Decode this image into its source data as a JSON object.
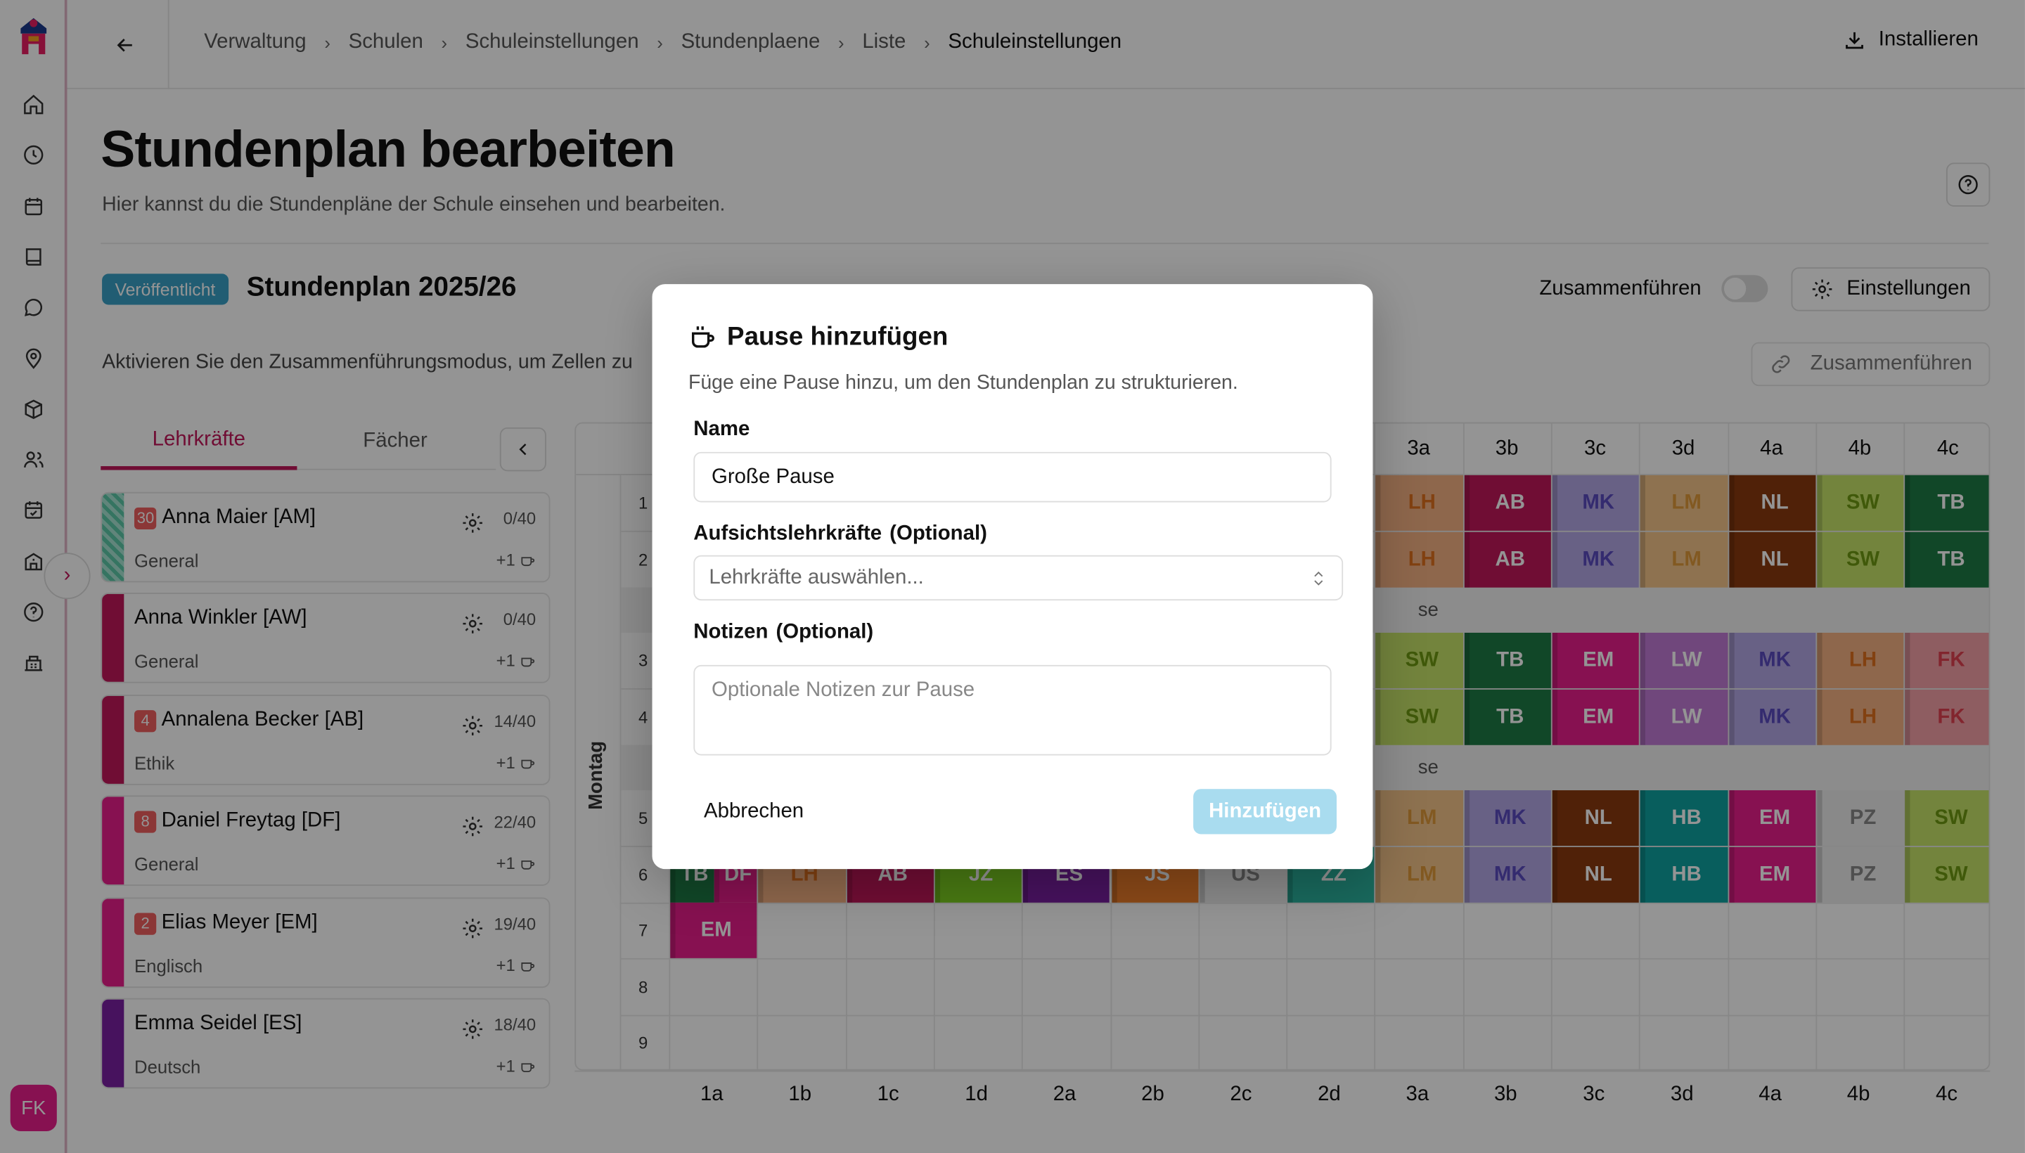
{
  "topbar": {
    "breadcrumb": [
      "Verwaltung",
      "Schulen",
      "Schuleinstellungen",
      "Stundenplaene",
      "Liste",
      "Schuleinstellungen"
    ],
    "install_label": "Installieren"
  },
  "sidebar": {
    "icons": [
      "home-icon",
      "clock-icon",
      "calendar-icon",
      "book-icon",
      "chat-icon",
      "map-pin-icon",
      "package-icon",
      "users-icon",
      "calendar-check-icon",
      "school-icon",
      "help-icon",
      "building-icon"
    ],
    "user_initials": "FK"
  },
  "page": {
    "title": "Stundenplan bearbeiten",
    "subtitle": "Hier kannst du die Stundenpläne der Schule einsehen und bearbeiten."
  },
  "plan": {
    "status_badge": "Veröffentlicht",
    "name": "Stundenplan 2025/26",
    "merge_toggle_label": "Zusammenführen",
    "settings_label": "Einstellungen",
    "merge_info": "Aktivieren Sie den Zusammenführungsmodus, um Zellen zu",
    "merge_button_label": "Zusammenführen"
  },
  "tabs": [
    {
      "label": "Lehrkräfte",
      "active": true
    },
    {
      "label": "Fächer",
      "active": false
    }
  ],
  "teachers": [
    {
      "badge": "30",
      "name": "Anna Maier [AM]",
      "subject": "General",
      "count": "0/40",
      "extra": "+1",
      "color": "#5cc8a8",
      "striped": true
    },
    {
      "badge": "",
      "name": "Anna Winkler [AW]",
      "subject": "General",
      "count": "0/40",
      "extra": "+1",
      "color": "#c2185b",
      "striped": false
    },
    {
      "badge": "4",
      "name": "Annalena Becker [AB]",
      "subject": "Ethik",
      "count": "14/40",
      "extra": "+1",
      "color": "#c2185b",
      "striped": false
    },
    {
      "badge": "8",
      "name": "Daniel Freytag [DF]",
      "subject": "General",
      "count": "22/40",
      "extra": "+1",
      "color": "#e91e8c",
      "striped": false
    },
    {
      "badge": "2",
      "name": "Elias Meyer [EM]",
      "subject": "Englisch",
      "count": "19/40",
      "extra": "+1",
      "color": "#e91e8c",
      "striped": false
    },
    {
      "badge": "",
      "name": "Emma Seidel [ES]",
      "subject": "Deutsch",
      "count": "18/40",
      "extra": "+1",
      "color": "#7b1fa2",
      "striped": false
    }
  ],
  "grid": {
    "classes": [
      "1a",
      "1b",
      "1c",
      "1d",
      "2a",
      "2b",
      "2c",
      "2d",
      "3a",
      "3b",
      "3c",
      "3d",
      "4a",
      "4b",
      "4c"
    ],
    "visible_header_classes": [
      "3a",
      "3b",
      "3c",
      "3d",
      "4a",
      "4b",
      "4c"
    ],
    "periods": [
      "1",
      "2",
      "3",
      "4",
      "5",
      "6",
      "7",
      "8",
      "9"
    ],
    "day": "Montag",
    "pause_fragment": "se",
    "lessons": [
      {
        "period": 1,
        "class": "3a",
        "code": "LH",
        "color": "#f4b183"
      },
      {
        "period": 1,
        "class": "3b",
        "code": "AB",
        "color": "#c2185b"
      },
      {
        "period": 1,
        "class": "3c",
        "code": "MK",
        "color": "#b4a7e5"
      },
      {
        "period": 1,
        "class": "3d",
        "code": "LM",
        "color": "#f4c48a"
      },
      {
        "period": 1,
        "class": "4a",
        "code": "NL",
        "color": "#8b3a0f"
      },
      {
        "period": 1,
        "class": "4b",
        "code": "SW",
        "color": "#c6e46a"
      },
      {
        "period": 1,
        "class": "4c",
        "code": "TB",
        "color": "#1e7a45"
      },
      {
        "period": 2,
        "class": "3a",
        "code": "LH",
        "color": "#f4b183"
      },
      {
        "period": 2,
        "class": "3b",
        "code": "AB",
        "color": "#c2185b"
      },
      {
        "period": 2,
        "class": "3c",
        "code": "MK",
        "color": "#b4a7e5"
      },
      {
        "period": 2,
        "class": "3d",
        "code": "LM",
        "color": "#f4c48a"
      },
      {
        "period": 2,
        "class": "4a",
        "code": "NL",
        "color": "#8b3a0f"
      },
      {
        "period": 2,
        "class": "4b",
        "code": "SW",
        "color": "#c6e46a"
      },
      {
        "period": 2,
        "class": "4c",
        "code": "TB",
        "color": "#1e7a45"
      },
      {
        "period": 3,
        "class": "3a",
        "code": "SW",
        "color": "#c6e46a"
      },
      {
        "period": 3,
        "class": "3b",
        "code": "TB",
        "color": "#1e7a45"
      },
      {
        "period": 3,
        "class": "3c",
        "code": "EM",
        "color": "#e91e8c"
      },
      {
        "period": 3,
        "class": "3d",
        "code": "LW",
        "color": "#c27bd6"
      },
      {
        "period": 3,
        "class": "4a",
        "code": "MK",
        "color": "#b4a7e5"
      },
      {
        "period": 3,
        "class": "4b",
        "code": "LH",
        "color": "#f4b183"
      },
      {
        "period": 3,
        "class": "4c",
        "code": "FK",
        "color": "#f4a0a8"
      },
      {
        "period": 4,
        "class": "3a",
        "code": "SW",
        "color": "#c6e46a"
      },
      {
        "period": 4,
        "class": "3b",
        "code": "TB",
        "color": "#1e7a45"
      },
      {
        "period": 4,
        "class": "3c",
        "code": "EM",
        "color": "#e91e8c"
      },
      {
        "period": 4,
        "class": "3d",
        "code": "LW",
        "color": "#c27bd6"
      },
      {
        "period": 4,
        "class": "4a",
        "code": "MK",
        "color": "#b4a7e5"
      },
      {
        "period": 4,
        "class": "4b",
        "code": "LH",
        "color": "#f4b183"
      },
      {
        "period": 4,
        "class": "4c",
        "code": "FK",
        "color": "#f4a0a8"
      },
      {
        "period": 5,
        "class": "3a",
        "code": "LM",
        "color": "#f4c48a"
      },
      {
        "period": 5,
        "class": "3b",
        "code": "MK",
        "color": "#b4a7e5"
      },
      {
        "period": 5,
        "class": "3c",
        "code": "NL",
        "color": "#8b3a0f"
      },
      {
        "period": 5,
        "class": "3d",
        "code": "HB",
        "color": "#0fa3a0"
      },
      {
        "period": 5,
        "class": "4a",
        "code": "EM",
        "color": "#e91e8c"
      },
      {
        "period": 5,
        "class": "4b",
        "code": "PZ",
        "color": "#ececec"
      },
      {
        "period": 5,
        "class": "4c",
        "code": "SW",
        "color": "#c6e46a"
      },
      {
        "period": 6,
        "class": "1a",
        "code": "TB",
        "color": "#1e7a45"
      },
      {
        "period": 6,
        "class": "1a",
        "code": "DF",
        "color": "#e91e8c"
      },
      {
        "period": 6,
        "class": "1b",
        "code": "LH",
        "color": "#f4b183"
      },
      {
        "period": 6,
        "class": "1c",
        "code": "AB",
        "color": "#c2185b"
      },
      {
        "period": 6,
        "class": "1d",
        "code": "JZ",
        "color": "#7ed321"
      },
      {
        "period": 6,
        "class": "2a",
        "code": "ES",
        "color": "#7b1fa2"
      },
      {
        "period": 6,
        "class": "2b",
        "code": "JS",
        "color": "#f07f2a"
      },
      {
        "period": 6,
        "class": "2c",
        "code": "US",
        "color": "#eeeeee"
      },
      {
        "period": 6,
        "class": "2d",
        "code": "ZZ",
        "color": "#2bb5a0"
      },
      {
        "period": 6,
        "class": "3a",
        "code": "LM",
        "color": "#f4c48a"
      },
      {
        "period": 6,
        "class": "3b",
        "code": "MK",
        "color": "#b4a7e5"
      },
      {
        "period": 6,
        "class": "3c",
        "code": "NL",
        "color": "#8b3a0f"
      },
      {
        "period": 6,
        "class": "3d",
        "code": "HB",
        "color": "#0fa3a0"
      },
      {
        "period": 6,
        "class": "4a",
        "code": "EM",
        "color": "#e91e8c"
      },
      {
        "period": 6,
        "class": "4b",
        "code": "PZ",
        "color": "#ececec"
      },
      {
        "period": 6,
        "class": "4c",
        "code": "SW",
        "color": "#c6e46a"
      },
      {
        "period": 7,
        "class": "1a",
        "code": "EM",
        "color": "#e91e8c"
      }
    ]
  },
  "modal": {
    "title": "Pause hinzufügen",
    "description": "Füge eine Pause hinzu, um den Stundenplan zu strukturieren.",
    "name_label": "Name",
    "name_value": "Große Pause",
    "supervisors_label": "Aufsichtslehrkräfte",
    "supervisors_optional": "(Optional)",
    "supervisors_placeholder": "Lehrkräfte auswählen...",
    "notes_label": "Notizen",
    "notes_optional": "(Optional)",
    "notes_placeholder": "Optionale Notizen zur Pause",
    "cancel_label": "Abbrechen",
    "submit_label": "Hinzufügen"
  }
}
